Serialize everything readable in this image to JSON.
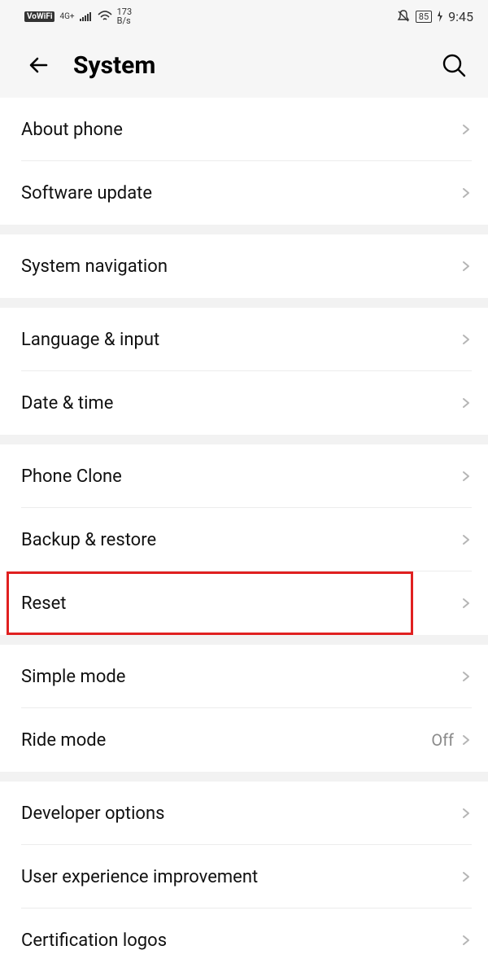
{
  "status": {
    "vowifi": "VoWiFi",
    "network_type": "4G+",
    "speed_value": "173",
    "speed_unit": "B/s",
    "battery": "85",
    "time": "9:45"
  },
  "header": {
    "title": "System"
  },
  "groups": [
    {
      "items": [
        {
          "id": "about-phone",
          "label": "About phone"
        },
        {
          "id": "software-update",
          "label": "Software update"
        }
      ]
    },
    {
      "items": [
        {
          "id": "system-navigation",
          "label": "System navigation"
        }
      ]
    },
    {
      "items": [
        {
          "id": "language-input",
          "label": "Language & input"
        },
        {
          "id": "date-time",
          "label": "Date & time"
        }
      ]
    },
    {
      "items": [
        {
          "id": "phone-clone",
          "label": "Phone Clone"
        },
        {
          "id": "backup-restore",
          "label": "Backup & restore"
        },
        {
          "id": "reset",
          "label": "Reset",
          "highlight": true
        }
      ]
    },
    {
      "items": [
        {
          "id": "simple-mode",
          "label": "Simple mode"
        },
        {
          "id": "ride-mode",
          "label": "Ride mode",
          "value": "Off"
        }
      ]
    },
    {
      "items": [
        {
          "id": "developer-options",
          "label": "Developer options"
        },
        {
          "id": "user-experience",
          "label": "User experience improvement"
        },
        {
          "id": "certification-logos",
          "label": "Certification logos"
        }
      ]
    }
  ]
}
